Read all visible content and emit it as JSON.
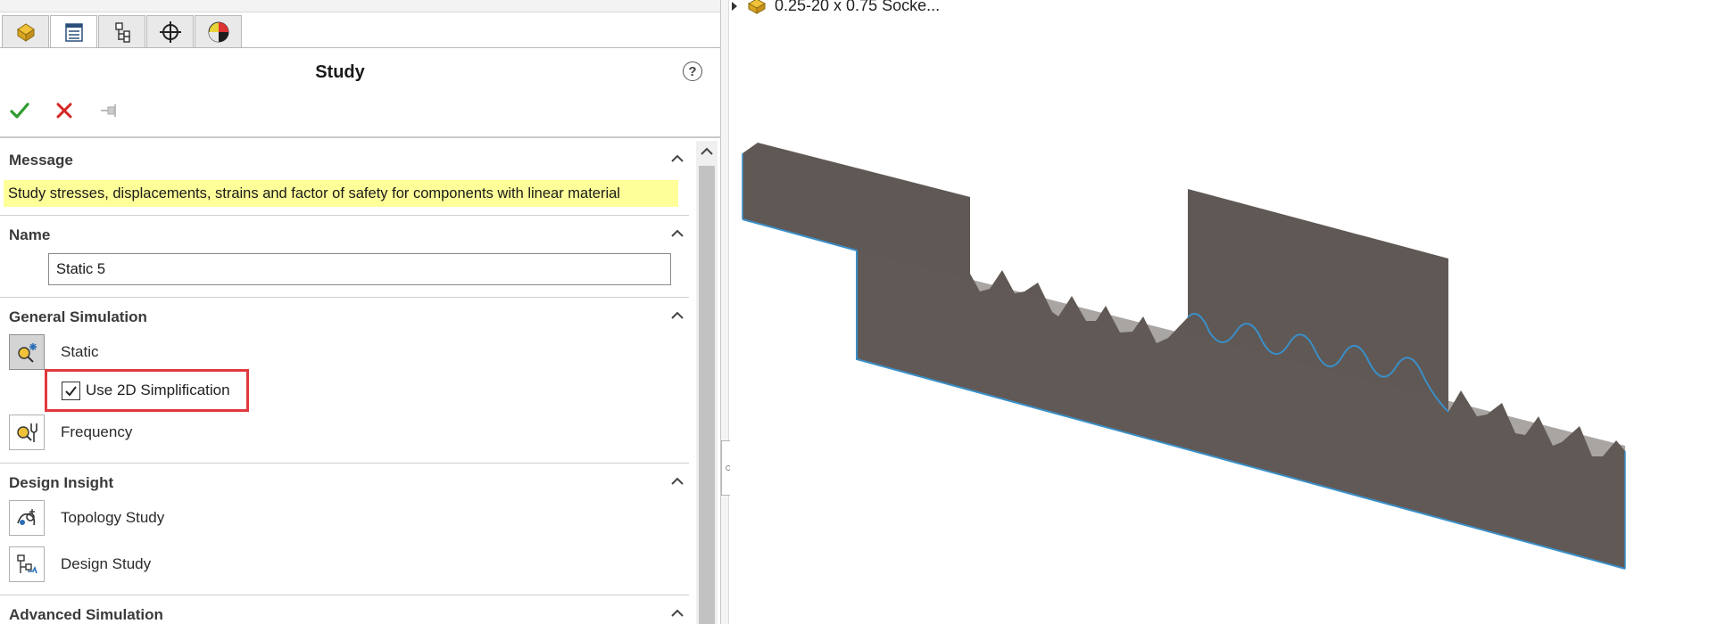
{
  "property_manager": {
    "tabs": [
      {
        "icon": "feature-manager-icon",
        "active": false
      },
      {
        "icon": "property-manager-icon",
        "active": true
      },
      {
        "icon": "configuration-manager-icon",
        "active": false
      },
      {
        "icon": "dimxpert-manager-icon",
        "active": false
      },
      {
        "icon": "display-manager-icon",
        "active": false
      }
    ],
    "title": "Study",
    "help": "?",
    "actions": [
      "ok-icon",
      "cancel-icon",
      "pushpin-icon"
    ],
    "groups": {
      "message": {
        "title": "Message",
        "text": "Study stresses, displacements, strains and factor of safety  for components with linear material"
      },
      "name": {
        "title": "Name",
        "value": "Static 5"
      },
      "general_simulation": {
        "title": "General Simulation",
        "options": [
          {
            "label": "Static",
            "icon": "static-study-icon",
            "selected": true
          },
          {
            "label": "Frequency",
            "icon": "frequency-study-icon",
            "selected": false
          }
        ],
        "checkbox": {
          "label": "Use 2D Simplification",
          "checked": true
        }
      },
      "design_insight": {
        "title": "Design Insight",
        "options": [
          {
            "label": "Topology Study",
            "icon": "topology-study-icon"
          },
          {
            "label": "Design Study",
            "icon": "design-study-icon"
          }
        ]
      },
      "advanced_simulation": {
        "title": "Advanced Simulation"
      }
    }
  },
  "viewport": {
    "tree_item_label": "0.25-20 x 0.75 Socke...",
    "model_fill": "#5f5854",
    "edge_color": "#3a8fc8"
  },
  "colors": {
    "message_highlight": "#ffff99",
    "callout_border": "#e0393e",
    "ok_green": "#2e9b2e",
    "cancel_red": "#d62626"
  }
}
